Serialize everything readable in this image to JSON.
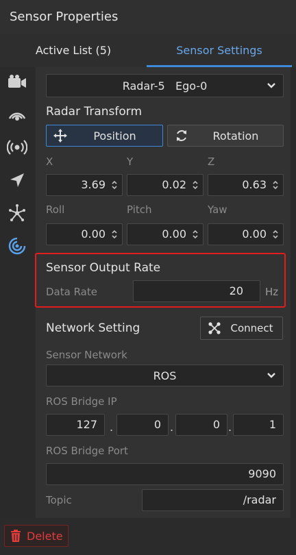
{
  "panel": {
    "title": "Sensor Properties"
  },
  "tabs": [
    {
      "label": "Active List (5)"
    },
    {
      "label": "Sensor Settings",
      "active": true
    }
  ],
  "sidebar": {
    "icons": [
      "camera-icon",
      "lidar-icon",
      "radar-icon",
      "gps-icon",
      "imu-icon",
      "ultrasonic-icon"
    ],
    "active_color": "#5aa0ea"
  },
  "sensor_select": {
    "value": "Radar-5   Ego-0"
  },
  "transform": {
    "title": "Radar Transform",
    "position_label": "Position",
    "rotation_label": "Rotation",
    "x_label": "X",
    "y_label": "Y",
    "z_label": "Z",
    "x": "3.69",
    "y": "0.02",
    "z": "0.63",
    "roll_label": "Roll",
    "pitch_label": "Pitch",
    "yaw_label": "Yaw",
    "roll": "0.00",
    "pitch": "0.00",
    "yaw": "0.00"
  },
  "output_rate": {
    "title": "Sensor Output Rate",
    "data_rate_label": "Data Rate",
    "data_rate": "20",
    "unit": "Hz"
  },
  "network": {
    "title": "Network Setting",
    "connect_label": "Connect",
    "sensor_network_label": "Sensor Network",
    "sensor_network": "ROS",
    "bridge_ip_label": "ROS Bridge IP",
    "ip": [
      "127",
      "0",
      "0",
      "1"
    ],
    "bridge_port_label": "ROS Bridge Port",
    "bridge_port": "9090",
    "topic_label": "Topic",
    "topic": "/radar"
  },
  "footer": {
    "delete_label": "Delete"
  },
  "colors": {
    "accent": "#3f8ad8",
    "highlight": "#e11d1d",
    "danger": "#e03c3c"
  }
}
